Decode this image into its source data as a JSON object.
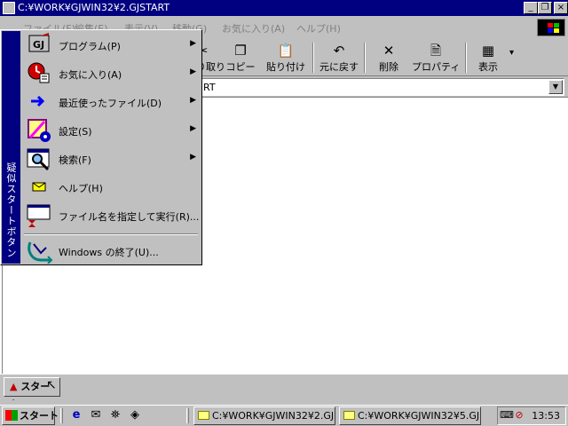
{
  "window": {
    "title": "C:¥WORK¥GJWIN32¥2.GJSTART",
    "buttons": {
      "minimize": "_",
      "maximize": "❐",
      "close": "×"
    }
  },
  "menubar": {
    "items": [
      "ファイル(F)",
      "編集(E)",
      "表示(V)",
      "移動(G)",
      "お気に入り(A)",
      "ヘルプ(H)"
    ]
  },
  "toolbar": {
    "buttons": [
      {
        "label": "切り取り",
        "icon": "scissors-icon"
      },
      {
        "label": "コピー",
        "icon": "copy-icon"
      },
      {
        "label": "貼り付け",
        "icon": "paste-icon"
      },
      {
        "label": "元に戻す",
        "icon": "undo-icon"
      },
      {
        "label": "削除",
        "icon": "delete-icon"
      },
      {
        "label": "プロパティ",
        "icon": "properties-icon"
      },
      {
        "label": "表示",
        "icon": "view-icon"
      }
    ],
    "view_dropdown": "▾"
  },
  "address": {
    "value": "RT",
    "dropdown": "▼"
  },
  "start_menu": {
    "banner": "疑似スタートボタン",
    "items": [
      {
        "label": "プログラム(P)",
        "icon": "programs-icon",
        "submenu": "▶"
      },
      {
        "label": "お気に入り(A)",
        "icon": "favorites-icon",
        "submenu": "▶"
      },
      {
        "label": "最近使ったファイル(D)",
        "icon": "documents-icon",
        "submenu": "▶"
      },
      {
        "label": "設定(S)",
        "icon": "settings-icon",
        "submenu": "▶"
      },
      {
        "label": "検索(F)",
        "icon": "find-icon",
        "submenu": "▶"
      },
      {
        "label": "ヘルプ(H)",
        "icon": "help-icon",
        "submenu": ""
      },
      {
        "label": "ファイル名を指定して実行(R)...",
        "icon": "run-icon",
        "submenu": ""
      },
      {
        "label": "Windows の終了(U)...",
        "icon": "shutdown-icon",
        "submenu": ""
      }
    ]
  },
  "pseudo_start_button": {
    "label": "スタート",
    "icon": "▲"
  },
  "taskbar": {
    "start_label": "スタート",
    "tasks": [
      "C:¥WORK¥GJWIN32¥2.GJ...",
      "C:¥WORK¥GJWIN32¥5.GJ..."
    ],
    "clock": "13:53"
  },
  "colors": {
    "titlebar": "#000080",
    "face": "#c0c0c0",
    "sidebanner": "#000080"
  }
}
